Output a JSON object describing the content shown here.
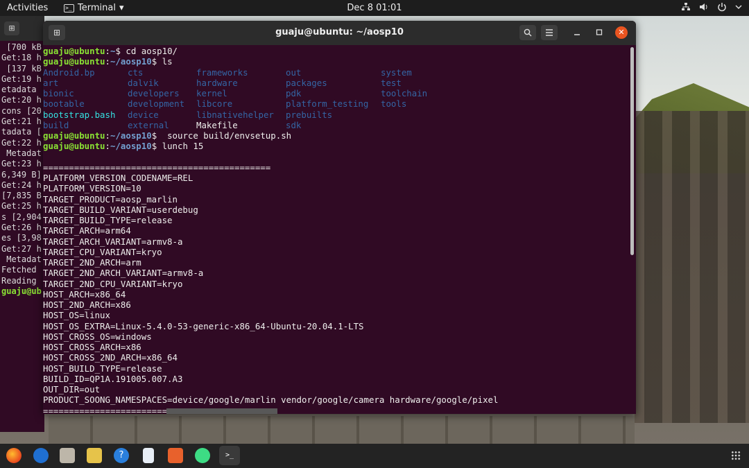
{
  "topbar": {
    "activities": "Activities",
    "app_name": "Terminal",
    "app_menu_arrow": "▾",
    "clock": "Dec 8  01:01",
    "icons": [
      "network-icon",
      "volume-icon",
      "power-icon",
      "chevron-down-icon"
    ]
  },
  "background_terminal": {
    "lines": [
      " [700 kB",
      "Get:18 h",
      " [137 kB",
      "Get:19 h",
      "etadata",
      "Get:20 h",
      "cons [20",
      "Get:21 h",
      "tadata [",
      "Get:22 h",
      " Metadat",
      "Get:23 h",
      "6,349 B]",
      "Get:24 h",
      "[7,835 B",
      "Get:25 h",
      "s [2,904",
      "Get:26 h",
      "es [3,98",
      "Get:27 h",
      " Metadat",
      "Fetched ",
      "Reading "
    ],
    "prompt": "guaju@ub"
  },
  "window": {
    "title": "guaju@ubuntu: ~/aosp10"
  },
  "terminal": {
    "prompt_user": "guaju@ubuntu",
    "cmd1": {
      "path": "~",
      "command": " cd aosp10/"
    },
    "cmd2": {
      "path": "~/aosp10",
      "command": " ls"
    },
    "ls_rows": [
      [
        {
          "t": "Android.bp",
          "k": "d"
        },
        {
          "t": "cts",
          "k": "d"
        },
        {
          "t": "frameworks",
          "k": "d"
        },
        {
          "t": "out",
          "k": "d"
        },
        {
          "t": "system",
          "k": "d"
        }
      ],
      [
        {
          "t": "art",
          "k": "d"
        },
        {
          "t": "dalvik",
          "k": "d"
        },
        {
          "t": "hardware",
          "k": "d"
        },
        {
          "t": "packages",
          "k": "d"
        },
        {
          "t": "test",
          "k": "d"
        }
      ],
      [
        {
          "t": "bionic",
          "k": "d"
        },
        {
          "t": "developers",
          "k": "d"
        },
        {
          "t": "kernel",
          "k": "d"
        },
        {
          "t": "pdk",
          "k": "d"
        },
        {
          "t": "toolchain",
          "k": "d"
        }
      ],
      [
        {
          "t": "bootable",
          "k": "d"
        },
        {
          "t": "development",
          "k": "d"
        },
        {
          "t": "libcore",
          "k": "d"
        },
        {
          "t": "platform_testing",
          "k": "d"
        },
        {
          "t": "tools",
          "k": "d"
        }
      ],
      [
        {
          "t": "bootstrap.bash",
          "k": "x"
        },
        {
          "t": "device",
          "k": "d"
        },
        {
          "t": "libnativehelper",
          "k": "d"
        },
        {
          "t": "prebuilts",
          "k": "d"
        },
        {
          "t": "",
          "k": "d"
        }
      ],
      [
        {
          "t": "build",
          "k": "d"
        },
        {
          "t": "external",
          "k": "d"
        },
        {
          "t": "Makefile",
          "k": "f"
        },
        {
          "t": "sdk",
          "k": "d"
        },
        {
          "t": "",
          "k": "d"
        }
      ]
    ],
    "cmd3": {
      "path": "~/aosp10",
      "command": "  source build/envsetup.sh"
    },
    "cmd4": {
      "path": "~/aosp10",
      "command": " lunch 15"
    },
    "output": [
      "",
      "============================================",
      "PLATFORM_VERSION_CODENAME=REL",
      "PLATFORM_VERSION=10",
      "TARGET_PRODUCT=aosp_marlin",
      "TARGET_BUILD_VARIANT=userdebug",
      "TARGET_BUILD_TYPE=release",
      "TARGET_ARCH=arm64",
      "TARGET_ARCH_VARIANT=armv8-a",
      "TARGET_CPU_VARIANT=kryo",
      "TARGET_2ND_ARCH=arm",
      "TARGET_2ND_ARCH_VARIANT=armv8-a",
      "TARGET_2ND_CPU_VARIANT=kryo",
      "HOST_ARCH=x86_64",
      "HOST_2ND_ARCH=x86",
      "HOST_OS=linux",
      "HOST_OS_EXTRA=Linux-5.4.0-53-generic-x86_64-Ubuntu-20.04.1-LTS",
      "HOST_CROSS_OS=windows",
      "HOST_CROSS_ARCH=x86",
      "HOST_CROSS_2ND_ARCH=x86_64",
      "HOST_BUILD_TYPE=release",
      "BUILD_ID=QP1A.191005.007.A3",
      "OUT_DIR=out",
      "PRODUCT_SOONG_NAMESPACES=device/google/marlin vendor/google/camera hardware/google/pixel",
      "============================================"
    ]
  },
  "colors": {
    "terminal_bg": "#300a24",
    "prompt_user": "#8ae234",
    "prompt_path": "#729fcf",
    "dir": "#3465a4",
    "exec": "#34e2e2",
    "close_button": "#e95420"
  },
  "dock": {
    "items": [
      "firefox-icon",
      "thunderbird-icon",
      "files-icon",
      "rhythmbox-icon",
      "help-icon",
      "writer-icon",
      "software-icon",
      "android-studio-icon",
      "terminal-icon"
    ],
    "apps_grid": "show-applications-icon"
  }
}
